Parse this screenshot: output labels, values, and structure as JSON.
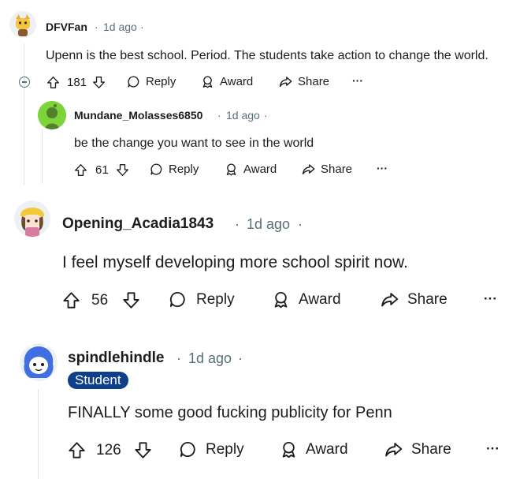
{
  "comments": [
    {
      "username": "DFVFan",
      "time": "1d ago",
      "sep": "·",
      "text": "Upenn is the best school. Period. The students take action to change the world.",
      "votes": "181",
      "reply": "Reply",
      "award": "Award",
      "share": "Share",
      "more": "···"
    },
    {
      "username": "Mundane_Molasses6850",
      "time": "1d ago",
      "sep": "·",
      "text": "be the change you want to see in the world",
      "votes": "61",
      "reply": "Reply",
      "award": "Award",
      "share": "Share",
      "more": "···"
    },
    {
      "username": "Opening_Acadia1843",
      "time": "1d ago",
      "sep": "·",
      "text": "I feel myself developing more school spirit now.",
      "votes": "56",
      "reply": "Reply",
      "award": "Award",
      "share": "Share",
      "more": "···"
    },
    {
      "username": "spindlehindle",
      "time": "1d ago",
      "sep": "·",
      "flair": "Student",
      "text": "FINALLY some good fucking publicity for Penn",
      "votes": "126",
      "reply": "Reply",
      "award": "Award",
      "share": "Share",
      "more": "···"
    }
  ],
  "colors": {
    "meta": "#576f76",
    "flair_bg": "#0f3f8a",
    "thread_line": "#e0e4e6",
    "avatar_green": "#7cd33a"
  },
  "icons": [
    "upvote-icon",
    "downvote-icon",
    "reply-bubble-icon",
    "award-icon",
    "share-arrow-icon",
    "collapse-icon"
  ]
}
